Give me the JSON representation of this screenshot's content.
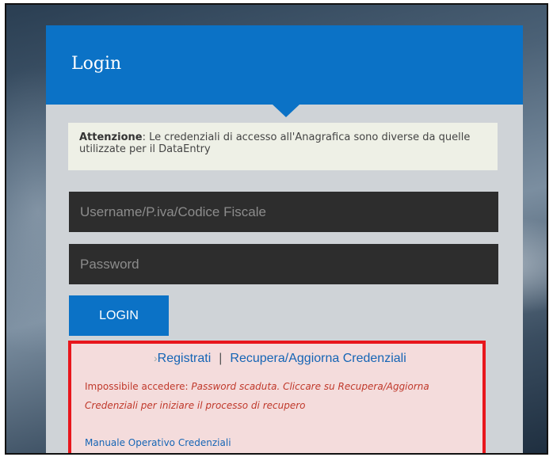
{
  "login": {
    "title": "Login",
    "notice_label": "Attenzione",
    "notice_text": ": Le credenziali di accesso all'Anagrafica sono diverse da quelle utilizzate per il DataEntry",
    "username_placeholder": "Username/P.iva/Codice Fiscale",
    "password_placeholder": "Password",
    "login_button": "LOGIN"
  },
  "links": {
    "register": "Registrati",
    "separator": "|",
    "recover": "Recupera/Aggiorna Credenziali",
    "manual": "Manuale Operativo Credenziali"
  },
  "error": {
    "prefix": "Impossibile accedere: ",
    "message": "Password scaduta. Cliccare su Recupera/Aggiorna Credenziali per iniziare il processo di recupero"
  },
  "colors": {
    "header_blue": "#0b72c6",
    "error_border": "#e8161c",
    "error_text": "#c0392b",
    "link_blue": "#1565b5"
  }
}
